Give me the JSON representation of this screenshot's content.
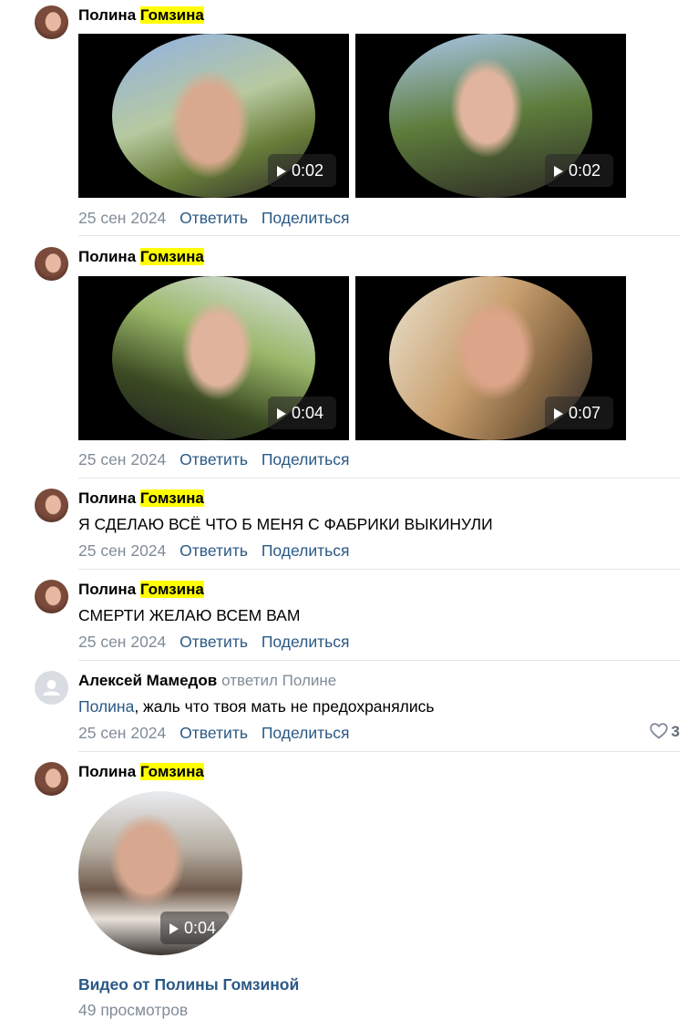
{
  "comments": [
    {
      "author_first": "Полина",
      "author_last": "Гомзина",
      "videos": [
        {
          "duration": "0:02"
        },
        {
          "duration": "0:02"
        }
      ],
      "date": "25 сен 2024",
      "reply_label": "Ответить",
      "share_label": "Поделиться"
    },
    {
      "author_first": "Полина",
      "author_last": "Гомзина",
      "videos": [
        {
          "duration": "0:04"
        },
        {
          "duration": "0:07"
        }
      ],
      "date": "25 сен 2024",
      "reply_label": "Ответить",
      "share_label": "Поделиться"
    },
    {
      "author_first": "Полина",
      "author_last": "Гомзина",
      "text": "Я СДЕЛАЮ ВСЁ ЧТО Б МЕНЯ С ФАБРИКИ ВЫКИНУЛИ",
      "date": "25 сен 2024",
      "reply_label": "Ответить",
      "share_label": "Поделиться"
    },
    {
      "author_first": "Полина",
      "author_last": "Гомзина",
      "text": "СМЕРТИ ЖЕЛАЮ ВСЕМ ВАМ",
      "date": "25 сен 2024",
      "reply_label": "Ответить",
      "share_label": "Поделиться"
    },
    {
      "author": "Алексей Мамедов",
      "replied_to": "ответил Полине",
      "text_mention": "Полина",
      "text_rest": ", жаль что твоя мать не предохранялись",
      "date": "25 сен 2024",
      "reply_label": "Ответить",
      "share_label": "Поделиться",
      "likes": "3"
    },
    {
      "author_first": "Полина",
      "author_last": "Гомзина",
      "video": {
        "duration": "0:04"
      },
      "video_title": "Видео от Полины Гомзиной",
      "views": "49 просмотров"
    }
  ],
  "colors": {
    "link": "#2a5885",
    "meta": "#818c99",
    "highlight": "#ffff00",
    "divider": "#e2e5ea"
  },
  "icons": [
    "play-icon",
    "heart-icon",
    "user-icon"
  ]
}
